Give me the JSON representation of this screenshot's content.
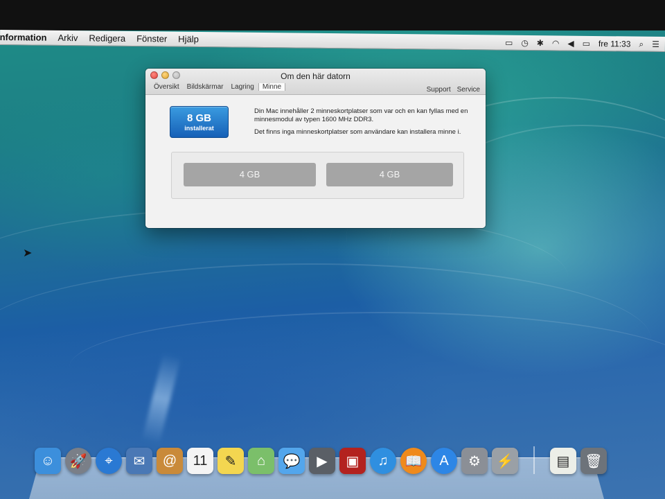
{
  "menubar": {
    "app_name": "Information",
    "menus": [
      "Arkiv",
      "Redigera",
      "Fönster",
      "Hjälp"
    ],
    "clock": "fre 11:33",
    "status_icons": [
      "airplay-icon",
      "time-machine-icon",
      "bluetooth-icon",
      "wifi-icon",
      "volume-icon",
      "battery-icon",
      "spotlight-icon",
      "notification-center-icon"
    ]
  },
  "window": {
    "title": "Om den här datorn",
    "tabs": [
      "Översikt",
      "Bildskärmar",
      "Lagring",
      "Minne"
    ],
    "active_tab": "Minne",
    "links": [
      "Support",
      "Service"
    ],
    "memory": {
      "installed_size": "8 GB",
      "installed_label": "installerat",
      "desc_1": "Din Mac innehåller 2 minneskortplatser som var och en kan fyllas med en minnesmodul av typen 1600 MHz DDR3.",
      "desc_2": "Det finns inga minneskortplatser som användare kan installera minne i.",
      "slots": [
        "4 GB",
        "4 GB"
      ]
    }
  },
  "dock": {
    "apps": [
      {
        "name": "finder",
        "glyph": "☺",
        "color": "#3c8fdc"
      },
      {
        "name": "launchpad",
        "glyph": "🚀",
        "color": "#7a7f88"
      },
      {
        "name": "safari",
        "glyph": "⌖",
        "color": "#2a79d3"
      },
      {
        "name": "mail-stamp",
        "glyph": "✉",
        "color": "#4a78b5"
      },
      {
        "name": "contacts",
        "glyph": "@",
        "color": "#c98a3a"
      },
      {
        "name": "calendar",
        "glyph": "11",
        "color": "#f4f4f4"
      },
      {
        "name": "notes",
        "glyph": "✎",
        "color": "#f3d650"
      },
      {
        "name": "maps",
        "glyph": "⌂",
        "color": "#7bbf6a"
      },
      {
        "name": "messages",
        "glyph": "💬",
        "color": "#53a6ec"
      },
      {
        "name": "facetime",
        "glyph": "▶",
        "color": "#5a5f66"
      },
      {
        "name": "photo-booth",
        "glyph": "▣",
        "color": "#b3221f"
      },
      {
        "name": "itunes",
        "glyph": "♫",
        "color": "#2f8fe0"
      },
      {
        "name": "ibooks",
        "glyph": "📖",
        "color": "#ef8a1c"
      },
      {
        "name": "app-store",
        "glyph": "A",
        "color": "#2d86e6"
      },
      {
        "name": "system-preferences",
        "glyph": "⚙",
        "color": "#8b8f96"
      },
      {
        "name": "system-information",
        "glyph": "⚡",
        "color": "#9aa0a6"
      }
    ],
    "stacks": [
      {
        "name": "document-stack",
        "glyph": "▤",
        "color": "#eceee8"
      },
      {
        "name": "trash",
        "glyph": "🗑",
        "color": "#6d737a"
      }
    ]
  }
}
